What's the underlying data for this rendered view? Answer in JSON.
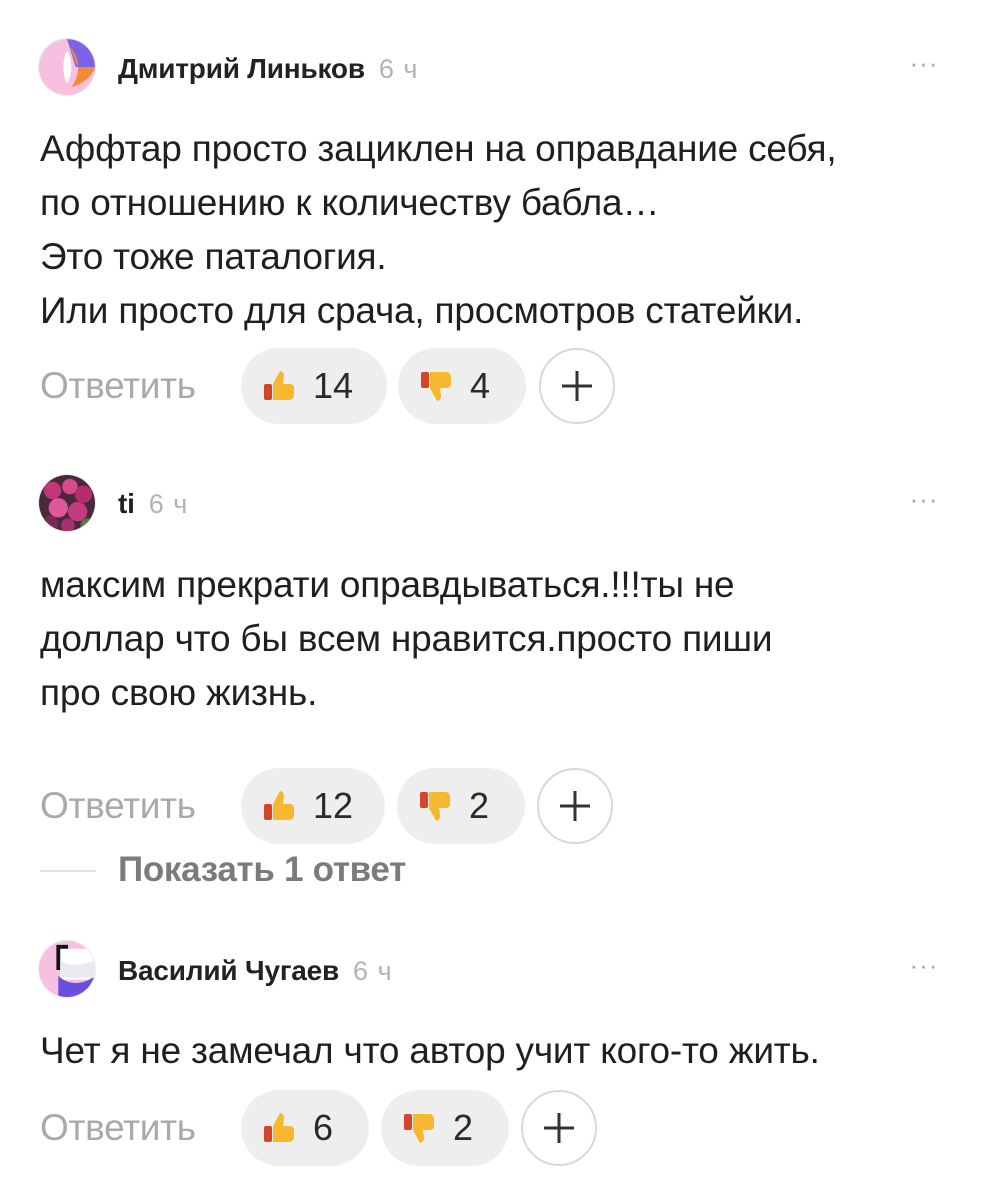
{
  "comments": [
    {
      "author": "Дмитрий Линьков",
      "time": "6 ч",
      "more": "···",
      "text_lines": [
        "Аффтар просто зациклен на оправдание себя,",
        "по отношению к количеству бабла…",
        "Это тоже паталогия.",
        "Или просто для срача, просмотров статейки."
      ],
      "reply_label": "Ответить",
      "likes": "14",
      "dislikes": "4",
      "avatar_icon": "pink-orange-abstract-avatar-icon"
    },
    {
      "author": "ti",
      "time": "6 ч",
      "more": "···",
      "text_lines": [
        "максим прекрати оправдываться.!!!ты не",
        "доллар что бы всем нравится.просто пиши",
        "про свою жизнь."
      ],
      "reply_label": "Ответить",
      "likes": "12",
      "dislikes": "2",
      "avatar_icon": "flowers-photo-avatar-icon"
    },
    {
      "author": "Василий Чугаев",
      "time": "6 ч",
      "more": "···",
      "text_lines": [
        "Чет я не замечал что автор учит кого-то жить."
      ],
      "reply_label": "Ответить",
      "likes": "6",
      "dislikes": "2",
      "avatar_icon": "pink-purple-abstract-avatar-icon"
    }
  ],
  "show_replies": "Показать 1 ответ",
  "colors": {
    "pill_bg": "#eeeeee",
    "muted_text": "#a9a9a9",
    "time_text": "#b3b3b3",
    "show_replies_text": "#7b7b7b"
  }
}
